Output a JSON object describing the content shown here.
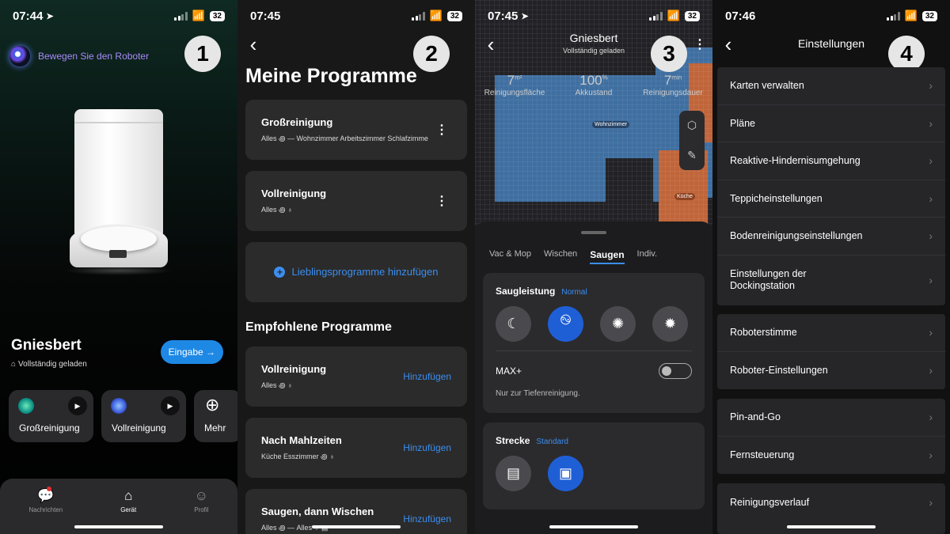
{
  "screen1": {
    "time": "07:44",
    "battery": "32",
    "marker": "1",
    "move_robot": "Bewegen Sie den Roboter",
    "device_name": "Gniesbert",
    "device_status": "Vollständig geladen",
    "input_button": "Eingabe →",
    "programs": [
      {
        "label": "Großreinigung"
      },
      {
        "label": "Vollreinigung"
      },
      {
        "label": "Mehr"
      }
    ],
    "tabs": [
      {
        "label": "Nachrichten",
        "icon": "chat-icon"
      },
      {
        "label": "Gerät",
        "icon": "home-icon"
      },
      {
        "label": "Profil",
        "icon": "profile-icon"
      }
    ]
  },
  "screen2": {
    "time": "07:45",
    "battery": "32",
    "marker": "2",
    "title": "Meine Programme",
    "my_programs": [
      {
        "title": "Großreinigung",
        "sub": "Alles ꩜ — Wohnzimmer Arbeitszimmer Schlafzimme"
      },
      {
        "title": "Vollreinigung",
        "sub": "Alles ꩜ ♁"
      }
    ],
    "add_favorite": "Lieblingsprogramme hinzufügen",
    "recommended_title": "Empfohlene Programme",
    "recommended": [
      {
        "title": "Vollreinigung",
        "sub": "Alles ꩜ ♁",
        "action": "Hinzufügen"
      },
      {
        "title": "Nach Mahlzeiten",
        "sub": "Küche Esszimmer ꩜ ♁",
        "action": "Hinzufügen"
      },
      {
        "title": "Saugen, dann Wischen",
        "sub": "Alles ꩜ — Alles ♁ ▤",
        "action": "Hinzufügen"
      }
    ]
  },
  "screen3": {
    "time": "07:45",
    "battery": "32",
    "marker": "3",
    "robot_name": "Gniesbert",
    "robot_status": "Vollständig geladen",
    "stats": [
      {
        "value": "7",
        "unit": "m²",
        "label": "Reinigungsfläche"
      },
      {
        "value": "100",
        "unit": "%",
        "label": "Akkustand"
      },
      {
        "value": "7",
        "unit": "min",
        "label": "Reinigungsdauer"
      }
    ],
    "rooms": {
      "living": "Wohnzimmer",
      "kitchen": "Küche"
    },
    "tabs": [
      "Vac & Mop",
      "Wischen",
      "Saugen",
      "Indiv."
    ],
    "suction_title": "Saugleistung",
    "suction_mode": "Normal",
    "max_label": "MAX+",
    "max_note": "Nur zur Tiefenreinigung.",
    "route_title": "Strecke",
    "route_mode": "Standard"
  },
  "screen4": {
    "time": "07:46",
    "battery": "32",
    "marker": "4",
    "title": "Einstellungen",
    "group1": [
      "Karten verwalten",
      "Pläne",
      "Reaktive-Hindernisumgehung",
      "Teppicheinstellungen",
      "Bodenreinigungseinstellungen",
      "Einstellungen der Dockingstation"
    ],
    "group2": [
      "Roboterstimme",
      "Roboter-Einstellungen"
    ],
    "group3": [
      "Pin-and-Go",
      "Fernsteuerung"
    ],
    "group4": [
      "Reinigungsverlauf"
    ]
  },
  "colors": {
    "accent": "#3b8ef0",
    "selected_mode": "#1f5fd6",
    "map_blue": "#3f6fa0",
    "map_orange": "#c0653a"
  }
}
